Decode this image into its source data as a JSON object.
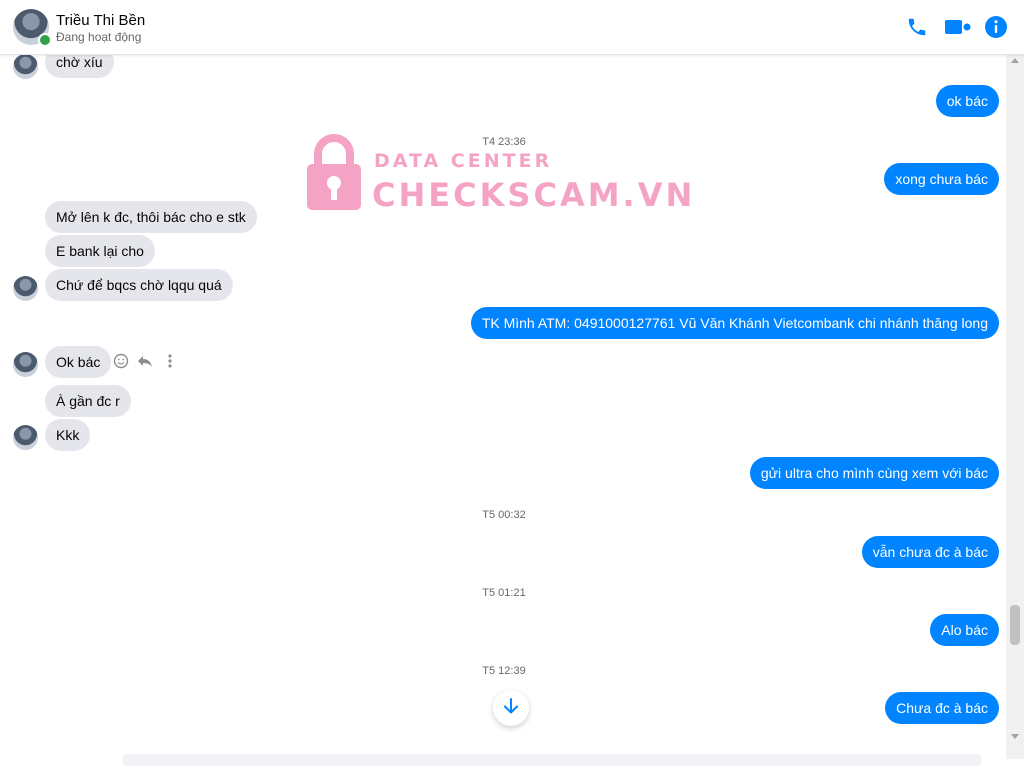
{
  "header": {
    "name": "Triều Thi Bền",
    "status": "Đang hoạt động"
  },
  "colors": {
    "outgoing_bubble": "#0084ff",
    "incoming_bubble": "#e4e6eb",
    "online": "#31a24c",
    "watermark": "#f5a3c4"
  },
  "icons": [
    "phone-icon",
    "video-call-icon",
    "info-icon",
    "emoji-icon",
    "reply-icon",
    "more-icon",
    "arrow-down-icon",
    "lock-icon"
  ],
  "watermark": {
    "top": "DATA CENTER",
    "main": "CHECKSCAM.VN"
  },
  "messages": {
    "m1": "chờ xíu",
    "m2": "ok bác",
    "m3": "xong chưa bác",
    "m4": "Mở lên k đc, thôi bác cho e stk",
    "m5": "E bank lại cho",
    "m6": "Chứ để bqcs chờ lqqu quá",
    "m7": "TK Mình ATM: 0491000127761 Vũ Văn Khánh Vietcombank chi nhánh thăng long",
    "m8": "Ok bác",
    "m9": "À gần đc r",
    "m10": "Kkk",
    "m11": "gửi ultra cho mình cùng xem với bác",
    "m12": "vẫn chưa đc à bác",
    "m13": "Alo bác",
    "m14": "Chưa đc à bác"
  },
  "timestamps": {
    "t1": "T4 23:36",
    "t2": "T5 00:32",
    "t3": "T5 01:21",
    "t4": "T5 12:39"
  }
}
